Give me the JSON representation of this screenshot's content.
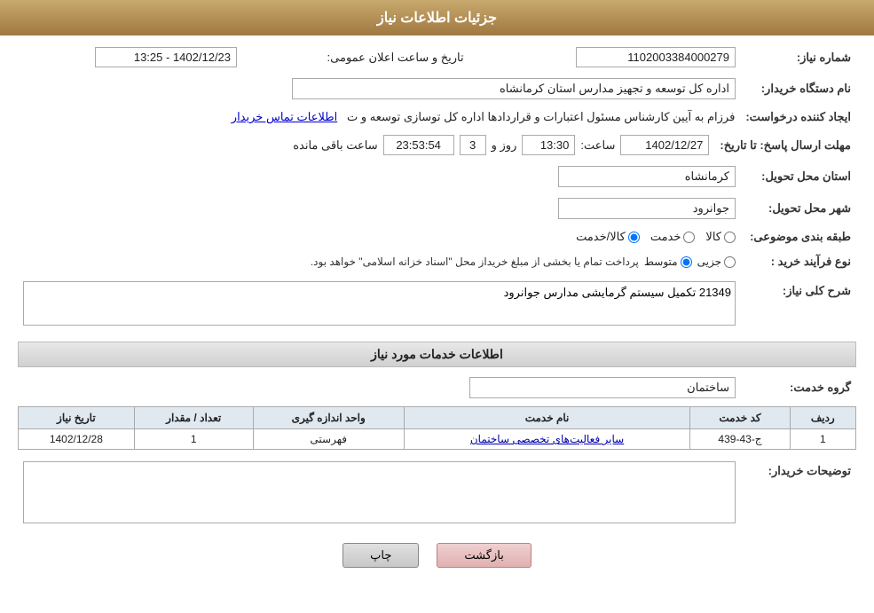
{
  "header": {
    "title": "جزئیات اطلاعات نیاز"
  },
  "fields": {
    "shomara_niaz_label": "شماره نیاز:",
    "shomara_niaz_value": "1102003384000279",
    "nam_dastgah_label": "نام دستگاه خریدار:",
    "nam_dastgah_value": "اداره کل توسعه  و تجهیز مدارس استان کرمانشاه",
    "ijad_konande_label": "ایجاد کننده درخواست:",
    "ijad_konande_value": "فرزام به آیین کارشناس مسئول اعتبارات و قراردادها اداره کل توسازی  توسعه و ت",
    "ijad_konande_link": "اطلاعات تماس خریدار",
    "mohlat_label": "مهلت ارسال پاسخ: تا تاریخ:",
    "mohlat_date": "1402/12/27",
    "mohlat_saat_label": "ساعت:",
    "mohlat_saat": "13:30",
    "mohlat_roz_label": "روز و",
    "mohlat_roz": "3",
    "mohlat_countdown": "23:53:54",
    "mohlat_baqi": "ساعت باقی مانده",
    "ostan_label": "استان محل تحویل:",
    "ostan_value": "کرمانشاه",
    "shahr_label": "شهر محل تحویل:",
    "shahr_value": "جوانرود",
    "tabaqe_label": "طبقه بندی موضوعی:",
    "tabaqe_kala": "کالا",
    "tabaqe_khadamat": "خدمت",
    "tabaqe_kala_khadamat": "کالا/خدمت",
    "noue_farayand_label": "نوع فرآیند خرید :",
    "noue_jozyi": "جزیی",
    "noue_motavasset": "متوسط",
    "noue_desc": "پرداخت تمام یا بخشی از مبلغ خریداز محل \"اسناد خزانه اسلامی\" خواهد بود.",
    "sharh_label": "شرح کلی نیاز:",
    "sharh_value": "21349 تکمیل سیستم گرمایشی مدارس جوانرود",
    "services_section_title": "اطلاعات خدمات مورد نیاز",
    "gorohe_khadamat_label": "گروه خدمت:",
    "gorohe_khadamat_value": "ساختمان",
    "table_headers": [
      "ردیف",
      "کد خدمت",
      "نام خدمت",
      "واحد اندازه گیری",
      "تعداد / مقدار",
      "تاریخ نیاز"
    ],
    "table_rows": [
      {
        "radif": "1",
        "kod_khadamat": "ج-43-439",
        "nam_khadamat": "سایر فعالیت‌های تخصصی ساختمان",
        "vahed": "فهرستی",
        "tedad": "1",
        "tarikh": "1402/12/28"
      }
    ],
    "tozihat_label": "توضیحات خریدار:",
    "tozihat_value": "",
    "btn_print": "چاپ",
    "btn_back": "بازگشت"
  }
}
